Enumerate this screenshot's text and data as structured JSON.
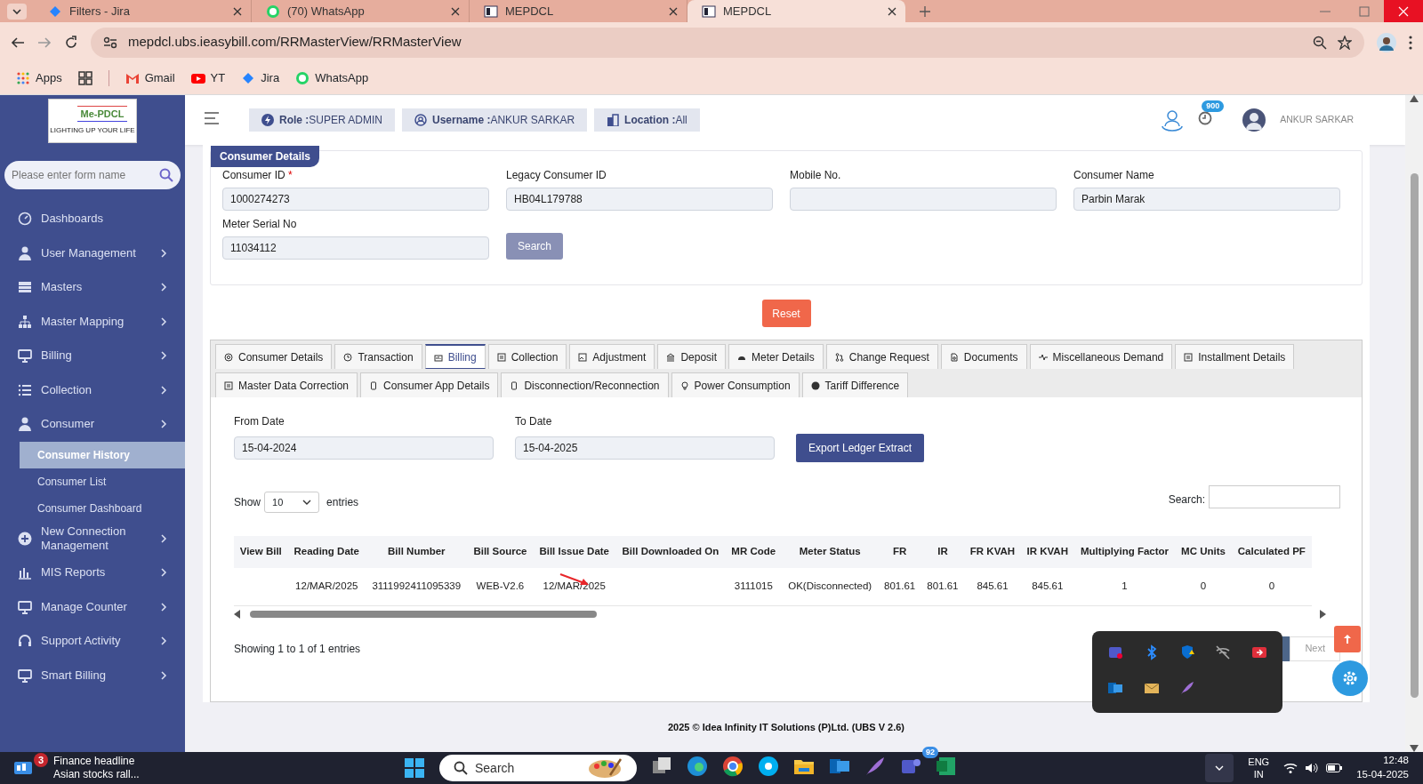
{
  "browser": {
    "tabs": [
      {
        "title": "Filters - Jira",
        "selected": false
      },
      {
        "title": "(70) WhatsApp",
        "selected": false
      },
      {
        "title": "MEPDCL",
        "selected": false
      },
      {
        "title": "MEPDCL",
        "selected": true
      }
    ],
    "url": "mepdcl.ubs.ieasybill.com/RRMasterView/RRMasterView",
    "bookmarks": [
      {
        "label": "Apps"
      },
      {
        "label": "Gmail"
      },
      {
        "label": "YT"
      },
      {
        "label": "Jira"
      },
      {
        "label": "WhatsApp"
      }
    ]
  },
  "sidebar": {
    "logo_text": "Me-PDCL",
    "logo_tagline": "LIGHTING UP YOUR LIFE",
    "search_placeholder": "Please enter form name",
    "items": [
      {
        "label": "Dashboards",
        "submenu": false
      },
      {
        "label": "User Management",
        "submenu": true
      },
      {
        "label": "Masters",
        "submenu": true
      },
      {
        "label": "Master Mapping",
        "submenu": true
      },
      {
        "label": "Billing",
        "submenu": true
      },
      {
        "label": "Collection",
        "submenu": true
      },
      {
        "label": "Consumer",
        "submenu": true,
        "children": [
          {
            "label": "Consumer History",
            "selected": true
          },
          {
            "label": "Consumer List",
            "selected": false
          },
          {
            "label": "Consumer Dashboard",
            "selected": false
          }
        ]
      },
      {
        "label": "New Connection Management",
        "submenu": true
      },
      {
        "label": "MIS Reports",
        "submenu": true
      },
      {
        "label": "Manage Counter",
        "submenu": true
      },
      {
        "label": "Support Activity",
        "submenu": true
      },
      {
        "label": "Smart Billing",
        "submenu": true
      }
    ]
  },
  "header": {
    "chips": [
      {
        "label": "Role :",
        "value": "SUPER ADMIN"
      },
      {
        "label": "Username :",
        "value": "ANKUR SARKAR"
      },
      {
        "label": "Location :",
        "value": "All"
      }
    ],
    "notification_count": "900",
    "user_name": "ANKUR SARKAR"
  },
  "consumer_form": {
    "title": "Consumer Details",
    "fields": [
      {
        "label": "Consumer ID",
        "value": "1000274273",
        "required": true
      },
      {
        "label": "Legacy Consumer ID",
        "value": "HB04L179788",
        "required": false
      },
      {
        "label": "Mobile No.",
        "required": false
      },
      {
        "label": "Consumer Name",
        "value": "Parbin Marak",
        "required": false
      },
      {
        "label": "Meter Serial No",
        "value": "11034112",
        "required": false
      }
    ],
    "required_mark": "*",
    "search_button": "Search",
    "reset_button": "Reset"
  },
  "tabs": [
    {
      "label": "Consumer Details",
      "selected": false
    },
    {
      "label": "Transaction",
      "selected": false
    },
    {
      "label": "Billing",
      "selected": true
    },
    {
      "label": "Collection",
      "selected": false
    },
    {
      "label": "Adjustment",
      "selected": false
    },
    {
      "label": "Deposit",
      "selected": false
    },
    {
      "label": "Meter Details",
      "selected": false
    },
    {
      "label": "Change Request",
      "selected": false
    },
    {
      "label": "Documents",
      "selected": false
    },
    {
      "label": "Miscellaneous Demand",
      "selected": false
    },
    {
      "label": "Installment Details",
      "selected": false
    },
    {
      "label": "Master Data Correction",
      "selected": false
    },
    {
      "label": "Consumer App Details",
      "selected": false
    },
    {
      "label": "Disconnection/Reconnection",
      "selected": false
    },
    {
      "label": "Power Consumption",
      "selected": false
    },
    {
      "label": "Tariff Difference",
      "selected": false
    }
  ],
  "billing": {
    "from_label": "From Date",
    "from_value": "15-04-2024",
    "to_label": "To Date",
    "to_value": "15-04-2025",
    "export_button": "Export Ledger Extract",
    "show_label": "Show",
    "page_size": "10",
    "entries_label": "entries",
    "search_label": "Search:",
    "columns": [
      "View Bill",
      "Reading Date",
      "Bill Number",
      "Bill Source",
      "Bill Issue Date",
      "Bill Downloaded On",
      "MR Code",
      "Meter Status",
      "FR",
      "IR",
      "FR KVAH",
      "IR KVAH",
      "Multiplying Factor",
      "MC Units",
      "Calculated PF"
    ],
    "rows": [
      [
        "",
        "12/MAR/2025",
        "3111992411095339",
        "WEB-V2.6",
        "12/MAR/2025",
        "",
        "3111015",
        "OK(Disconnected)",
        "801.61",
        "801.61",
        "845.61",
        "845.61",
        "1",
        "0",
        "0"
      ]
    ],
    "info": "Showing 1 to 1 of 1 entries",
    "next_button": "Next"
  },
  "footer": "2025 © Idea Infinity IT Solutions (P)Ltd. (UBS V 2.6)",
  "taskbar": {
    "news_badge": "3",
    "news_title": "Finance headline",
    "news_subtitle": "Asian stocks rall...",
    "search": "Search",
    "teams_badge": "92",
    "lang": "ENG",
    "region": "IN",
    "time": "12:48",
    "date": "15-04-2025"
  }
}
